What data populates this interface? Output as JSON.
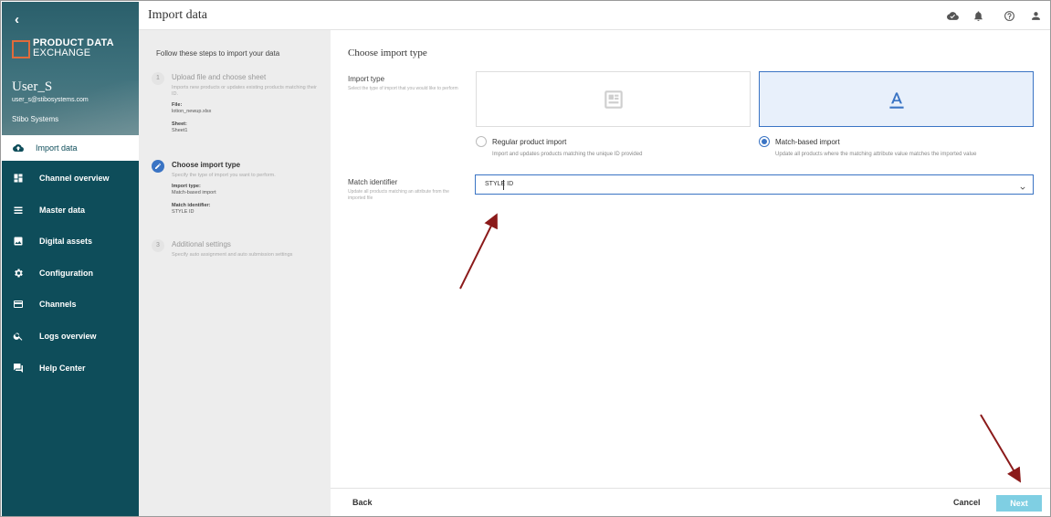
{
  "sidebar": {
    "logo_line1": "PRODUCT DATA",
    "logo_line2": "EXCHANGE",
    "user_name": "User_S",
    "user_email": "user_s@stibosystems.com",
    "org": "Stibo Systems",
    "items": [
      {
        "label": "Import data",
        "icon": "cloud-upload-icon"
      },
      {
        "label": "Channel overview",
        "icon": "dashboard-icon"
      },
      {
        "label": "Master data",
        "icon": "list-icon"
      },
      {
        "label": "Digital assets",
        "icon": "image-icon"
      },
      {
        "label": "Configuration",
        "icon": "gear-icon"
      },
      {
        "label": "Channels",
        "icon": "card-icon"
      },
      {
        "label": "Logs overview",
        "icon": "search-icon"
      },
      {
        "label": "Help Center",
        "icon": "chat-icon"
      }
    ]
  },
  "header": {
    "title": "Import data"
  },
  "steps": {
    "intro": "Follow these steps to import your data",
    "items": [
      {
        "number": "1",
        "title": "Upload file and choose sheet",
        "desc": "Imports new products or updates existing products matching their ID.",
        "file_label": "File:",
        "file_value": "lotion_newup.xlsx",
        "sheet_label": "Sheet:",
        "sheet_value": "Sheet1"
      },
      {
        "number": "2",
        "title": "Choose import type",
        "desc": "Specify the type of import you want to perform.",
        "type_label": "Import type:",
        "type_value": "Match-based import",
        "match_label": "Match identifier:",
        "match_value": "STYLE ID"
      },
      {
        "number": "3",
        "title": "Additional settings",
        "desc": "Specify auto assignment and auto submission settings"
      }
    ]
  },
  "main": {
    "section_title": "Choose import type",
    "import_type_label": "Import type",
    "import_type_help": "Select the type of import that you would like to perform",
    "option_regular": {
      "label": "Regular product import",
      "desc": "Import and updates products matching the unique ID provided",
      "selected": false
    },
    "option_match": {
      "label": "Match-based import",
      "desc": "Update all products where the matching attribute value matches the imported value",
      "selected": true
    },
    "match_label": "Match identifier",
    "match_help": "Update all products matching an attribute from the imported file",
    "match_value": "STYLE ID"
  },
  "footer": {
    "back": "Back",
    "cancel": "Cancel",
    "next": "Next"
  },
  "colors": {
    "sidebar": "#0e4d5a",
    "accent": "#3a74c4",
    "next_button": "#7fcfe3",
    "logo_mark": "#e06b3b",
    "annotation_arrow": "#8b1a1a"
  }
}
